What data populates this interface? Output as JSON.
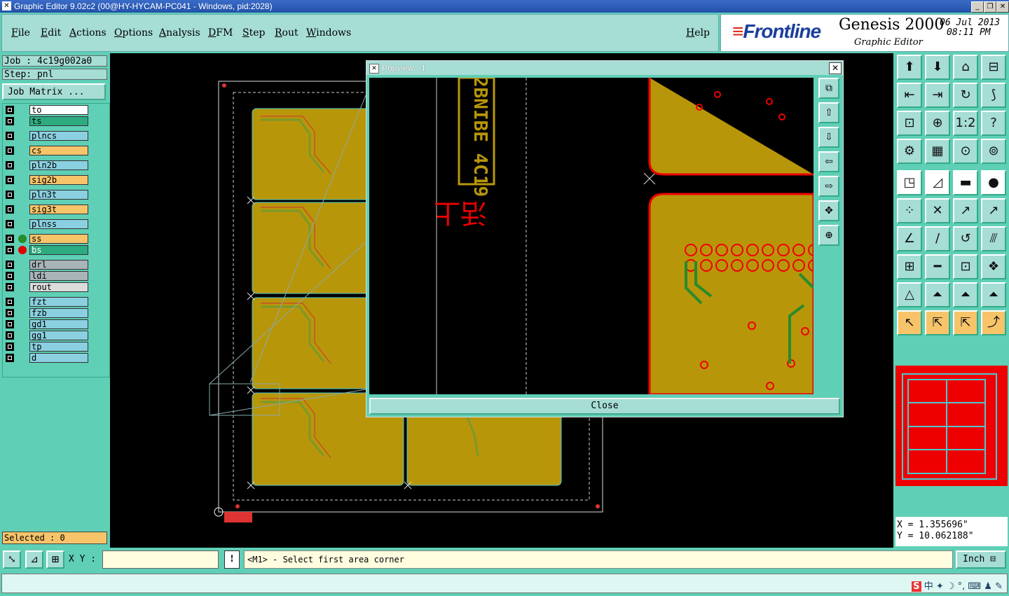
{
  "window": {
    "title": "Graphic Editor 9.02c2 (00@HY-HYCAM-PC041 - Windows, pid:2028)"
  },
  "menu": [
    "File",
    "Edit",
    "Actions",
    "Options",
    "Analysis",
    "DFM",
    "Step",
    "Rout",
    "Windows"
  ],
  "help": "Help",
  "brand": {
    "logo": "Frontline",
    "product": "Genesis 2000",
    "subtitle": "Graphic Editor",
    "date": "06 Jul 2013",
    "time": "08:11 PM"
  },
  "job": {
    "job": "Job : 4c19g002a0",
    "step": "Step: pnl",
    "matrix": "Job Matrix ..."
  },
  "layers": [
    {
      "name": "to",
      "color": "#ffffff"
    },
    {
      "name": "ts",
      "color": "#2eab80"
    },
    {
      "name": "plncs",
      "color": "#8ad0e0"
    },
    {
      "name": "cs",
      "color": "#f7c46a"
    },
    {
      "name": "pln2b",
      "color": "#8ad0e0"
    },
    {
      "name": "sig2b",
      "color": "#f7c46a"
    },
    {
      "name": "pln3t",
      "color": "#8ad0e0"
    },
    {
      "name": "sig3t",
      "color": "#f7c46a"
    },
    {
      "name": "plnss",
      "color": "#8ad0e0"
    },
    {
      "name": "ss",
      "color": "#f7c46a",
      "dot": "#2a8a2a"
    },
    {
      "name": "bs",
      "color": "#2eab80",
      "dot": "#e00000",
      "active": true
    },
    {
      "name": "drl",
      "color": "#a9b4b8"
    },
    {
      "name": "ldi",
      "color": "#a9b4b8"
    },
    {
      "name": "rout",
      "color": "#dcdcdc"
    },
    {
      "name": "fzt",
      "color": "#8ad0e0"
    },
    {
      "name": "fzb",
      "color": "#8ad0e0"
    },
    {
      "name": "gd1",
      "color": "#8ad0e0"
    },
    {
      "name": "gg1",
      "color": "#8ad0e0"
    },
    {
      "name": "tp",
      "color": "#8ad0e0"
    },
    {
      "name": "d",
      "color": "#8ad0e0"
    }
  ],
  "selected": "Selected : 0",
  "popview": {
    "title": "Popview - 1",
    "close": "Close",
    "board_text": "2BNIBE 4C19",
    "board_chars": "活上"
  },
  "coords": {
    "x": "X =  1.355696\"",
    "y": "Y = 10.062188\""
  },
  "bottom": {
    "xy_label": "X Y :",
    "xy_value": "",
    "prompt": "<M1> - Select first area corner",
    "unit": "Inch"
  },
  "ime": {
    "chars": "中"
  }
}
